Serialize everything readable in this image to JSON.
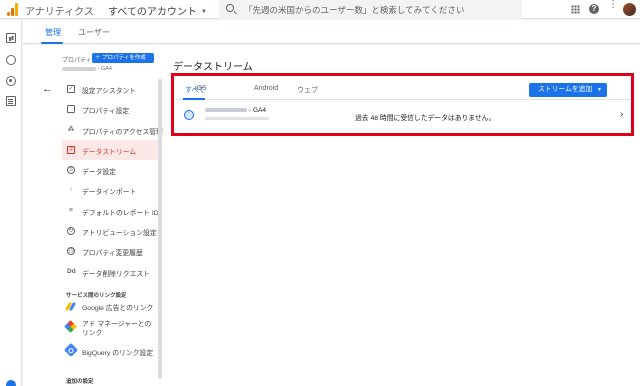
{
  "header": {
    "app_title": "アナリティクス",
    "account": "すべてのアカウント",
    "account_caret": "▼",
    "search_placeholder": "「先週の米国からのユーザー数」と検索してみてください",
    "help_glyph": "?",
    "more_glyph": "⋮"
  },
  "admin_tabs": [
    "管理",
    "ユーザー"
  ],
  "back_glyph": "←",
  "property": {
    "label": "プロパティ",
    "create_button": "＋ プロパティを作成",
    "name_suffix": "- GA4"
  },
  "menu": [
    {
      "label": "設定アシスタント",
      "icon": "checkbox-icon",
      "glyph": "✓"
    },
    {
      "label": "プロパティ設定",
      "icon": "property-icon",
      "glyph": ""
    },
    {
      "label": "プロパティのアクセス管理",
      "icon": "people-icon",
      "glyph": "⁂"
    },
    {
      "label": "データストリーム",
      "icon": "streams-icon",
      "glyph": "≡",
      "active": true
    },
    {
      "label": "データ設定",
      "icon": "database-icon",
      "glyph": "≡"
    },
    {
      "label": "データインポート",
      "icon": "upload-icon",
      "glyph": "↑"
    },
    {
      "label": "デフォルトのレポート ID",
      "icon": "report-id-icon",
      "glyph": "≡"
    },
    {
      "label": "アトリビューション設定",
      "icon": "attribution-icon",
      "glyph": "↻"
    },
    {
      "label": "プロパティ変更履歴",
      "icon": "history-icon",
      "glyph": "◷"
    },
    {
      "label": "データ削除リクエスト",
      "icon": "dd-icon",
      "glyph": "Dd"
    }
  ],
  "links_section": {
    "title": "サービス間のリンク設定",
    "items": [
      {
        "label": "Google 広告とのリンク",
        "icon": "google-ads-icon"
      },
      {
        "label": "アド マネージャーとのリンク",
        "icon": "ad-manager-icon"
      },
      {
        "label": "BigQuery のリンク設定",
        "icon": "bigquery-icon"
      }
    ]
  },
  "extra_section_title": "追加の設定",
  "data_streams": {
    "title": "データストリーム",
    "tabs": [
      "すべて",
      "iOS",
      "Android",
      "ウェブ"
    ],
    "add_button": "ストリームを追加",
    "add_button_caret": "▼",
    "stream": {
      "name_suffix": "- GA4",
      "status": "過去 48 時間に受信したデータはありません。",
      "chevron": "›"
    }
  },
  "colors": {
    "accent": "#1a73e8",
    "highlight_border": "#e0001b",
    "active_item": "#d93025"
  }
}
